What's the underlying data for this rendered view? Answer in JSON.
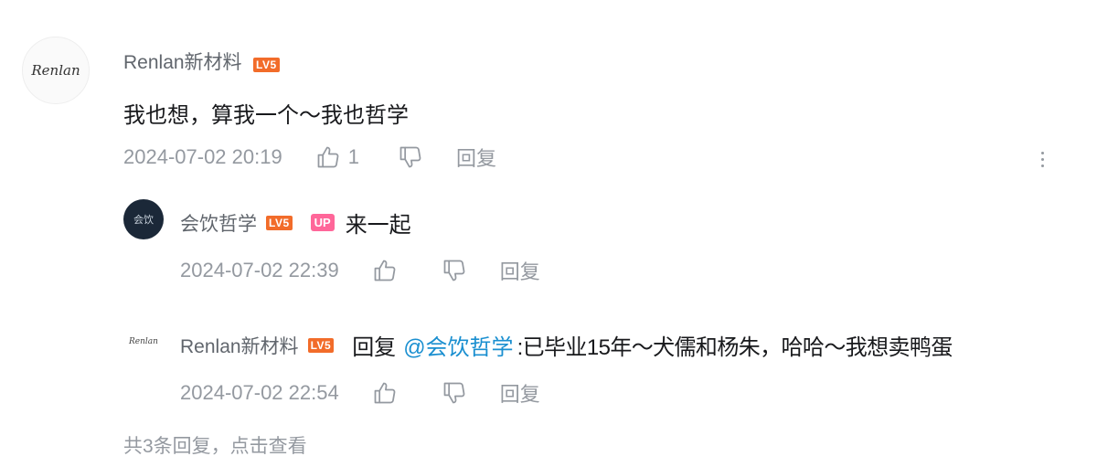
{
  "main_comment": {
    "avatar_text": "Renlan",
    "username": "Renlan新材料",
    "level": "LV5",
    "text": "我也想，算我一个～我也哲学",
    "time": "2024-07-02 20:19",
    "like_count": "1",
    "reply_label": "回复"
  },
  "replies": [
    {
      "avatar_text": "会饮",
      "username": "会饮哲学",
      "level": "LV5",
      "up_badge": "UP",
      "text": "来一起",
      "time": "2024-07-02 22:39",
      "reply_label": "回复"
    },
    {
      "avatar_text": "Renlan",
      "username": "Renlan新材料",
      "level": "LV5",
      "reply_prefix": "回复",
      "mention": "@会饮哲学",
      "text": ":已毕业15年～犬儒和杨朱，哈哈～我想卖鸭蛋",
      "time": "2024-07-02 22:54",
      "reply_label": "回复"
    }
  ],
  "footer": {
    "view_all": "共3条回复，点击查看"
  },
  "icons": {
    "like": "thumbs-up-icon",
    "dislike": "thumbs-down-icon",
    "more": "more-vertical-icon"
  },
  "colors": {
    "level_badge": "#f26c2a",
    "up_badge": "#ff6699",
    "mention": "#1a8fd0",
    "meta_text": "#9499a0"
  }
}
